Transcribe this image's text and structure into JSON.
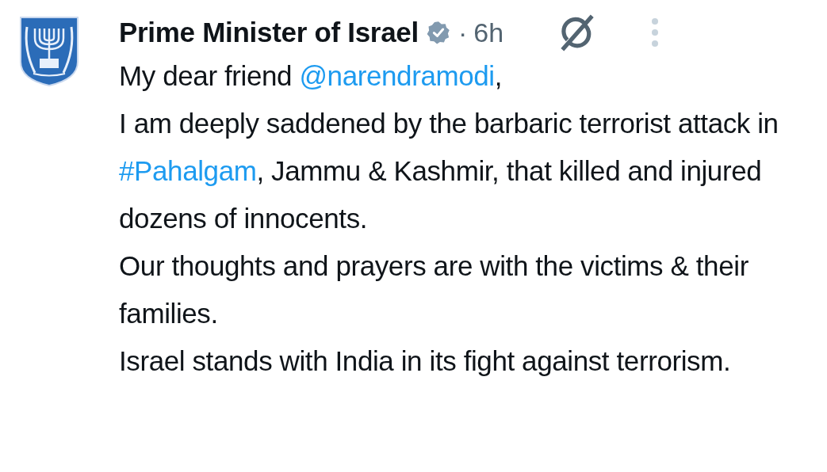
{
  "post": {
    "author": "Prime Minister of Israel",
    "verified": true,
    "separator": "·",
    "time": "6h",
    "paragraphs": [
      [
        {
          "kind": "text",
          "text": "My dear friend "
        },
        {
          "kind": "link",
          "text": "@narendramodi"
        },
        {
          "kind": "text",
          "text": ","
        }
      ],
      [
        {
          "kind": "text",
          "text": "I am deeply saddened by the barbaric terrorist attack in "
        },
        {
          "kind": "link",
          "text": "#Pahalgam"
        },
        {
          "kind": "text",
          "text": ", Jammu & Kashmir, that killed and injured dozens of innocents."
        }
      ],
      [
        {
          "kind": "text",
          "text": "Our thoughts and prayers are with the victims & their families."
        }
      ],
      [
        {
          "kind": "text",
          "text": "Israel stands with India in its fight against terrorism."
        }
      ]
    ]
  }
}
